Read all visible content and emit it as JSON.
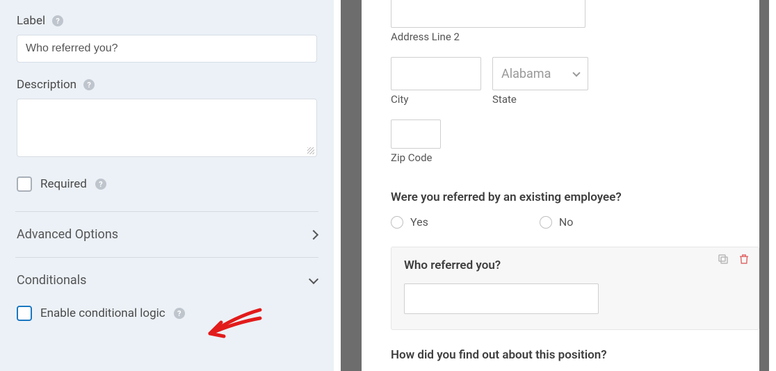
{
  "sidebar": {
    "label_heading": "Label",
    "label_value": "Who referred you?",
    "description_heading": "Description",
    "description_value": "",
    "required_label": "Required",
    "advanced_label": "Advanced Options",
    "conditionals_label": "Conditionals",
    "enable_cond_label": "Enable conditional logic"
  },
  "preview": {
    "addr2_label": "Address Line 2",
    "city_label": "City",
    "state_label": "State",
    "state_value": "Alabama",
    "zip_label": "Zip Code",
    "referred_question": "Were you referred by an existing employee?",
    "opt_yes": "Yes",
    "opt_no": "No",
    "who_referred_label": "Who referred you?",
    "how_find_label": "How did you find out about this position?"
  },
  "icons": {
    "duplicate": "duplicate-icon",
    "delete": "trash-icon"
  }
}
